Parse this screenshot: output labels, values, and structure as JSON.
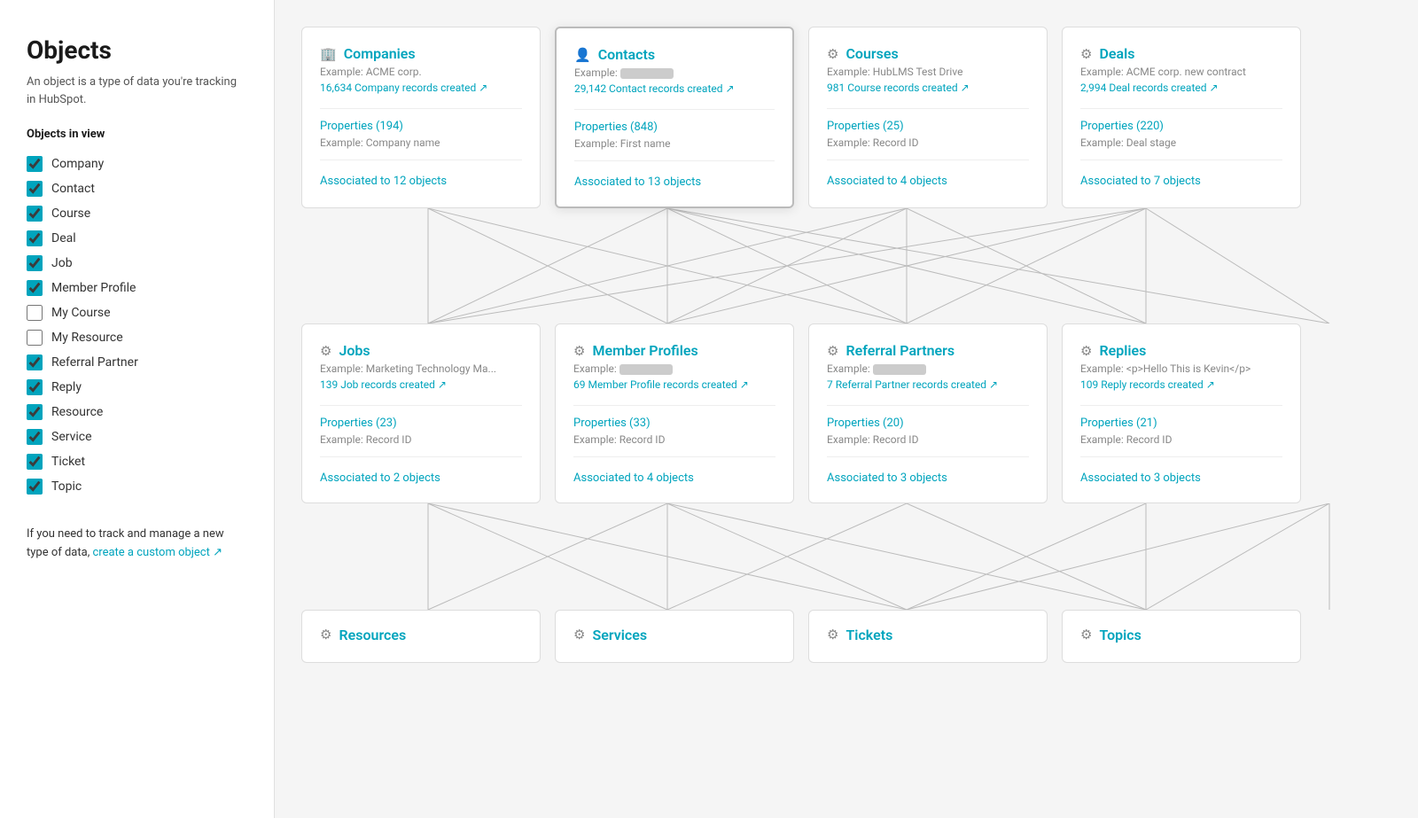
{
  "sidebar": {
    "title": "Objects",
    "description": "An object is a type of data you're tracking in HubSpot.",
    "section_title": "Objects in view",
    "items": [
      {
        "label": "Company",
        "checked": true
      },
      {
        "label": "Contact",
        "checked": true
      },
      {
        "label": "Course",
        "checked": true
      },
      {
        "label": "Deal",
        "checked": true
      },
      {
        "label": "Job",
        "checked": true
      },
      {
        "label": "Member Profile",
        "checked": true
      },
      {
        "label": "My Course",
        "checked": false
      },
      {
        "label": "My Resource",
        "checked": false
      },
      {
        "label": "Referral Partner",
        "checked": true
      },
      {
        "label": "Reply",
        "checked": true
      },
      {
        "label": "Resource",
        "checked": true
      },
      {
        "label": "Service",
        "checked": true
      },
      {
        "label": "Ticket",
        "checked": true
      },
      {
        "label": "Topic",
        "checked": true
      }
    ],
    "footer_text": "If you need to track and manage a new type of data, ",
    "footer_link": "create a custom object",
    "footer_icon": "↗"
  },
  "cards_row1": [
    {
      "id": "companies",
      "icon": "🏢",
      "title": "Companies",
      "example": "Example: ACME corp.",
      "records": "16,634 Company records created ↗",
      "properties": "Properties (194)",
      "prop_example": "Example: Company name",
      "associations": "Associated to 12 objects"
    },
    {
      "id": "contacts",
      "icon": "👤",
      "title": "Contacts",
      "example_blurred": true,
      "records": "29,142 Contact records created ↗",
      "properties": "Properties (848)",
      "prop_example": "Example: First name",
      "associations": "Associated to 13 objects",
      "highlighted": true
    },
    {
      "id": "courses",
      "icon": "⚙️",
      "title": "Courses",
      "example": "Example: HubLMS Test Drive",
      "records": "981 Course records created ↗",
      "properties": "Properties (25)",
      "prop_example": "Example: Record ID",
      "associations": "Associated to 4 objects"
    },
    {
      "id": "deals",
      "icon": "⚙️",
      "title": "Deals",
      "example": "Example: ACME corp. new contract",
      "records": "2,994 Deal records created ↗",
      "properties": "Properties (220)",
      "prop_example": "Example: Deal stage",
      "associations": "Associated to 7 objects"
    }
  ],
  "cards_row2": [
    {
      "id": "jobs",
      "icon": "⚙️",
      "title": "Jobs",
      "example": "Example: Marketing Technology Ma...",
      "records": "139 Job records created ↗",
      "properties": "Properties (23)",
      "prop_example": "Example: Record ID",
      "associations": "Associated to 2 objects"
    },
    {
      "id": "member-profiles",
      "icon": "⚙️",
      "title": "Member Profiles",
      "example_blurred": true,
      "records": "69 Member Profile records created ↗",
      "properties": "Properties (33)",
      "prop_example": "Example: Record ID",
      "associations": "Associated to 4 objects"
    },
    {
      "id": "referral-partners",
      "icon": "⚙️",
      "title": "Referral Partners",
      "example_blurred": true,
      "records": "7 Referral Partner records created ↗",
      "properties": "Properties (20)",
      "prop_example": "Example: Record ID",
      "associations": "Associated to 3 objects"
    },
    {
      "id": "replies",
      "icon": "⚙️",
      "title": "Replies",
      "example": "Example: <p>Hello This is Kevin</p>",
      "records": "109 Reply records created ↗",
      "properties": "Properties (21)",
      "prop_example": "Example: Record ID",
      "associations": "Associated to 3 objects"
    }
  ],
  "cards_row3": [
    {
      "id": "resources",
      "icon": "⚙️",
      "title": "Resources",
      "partial": true
    },
    {
      "id": "services",
      "icon": "⚙️",
      "title": "Services",
      "partial": true
    },
    {
      "id": "tickets",
      "icon": "🎫",
      "title": "Tickets",
      "partial": true
    },
    {
      "id": "topics",
      "icon": "⚙️",
      "title": "Topics",
      "partial": true
    }
  ]
}
